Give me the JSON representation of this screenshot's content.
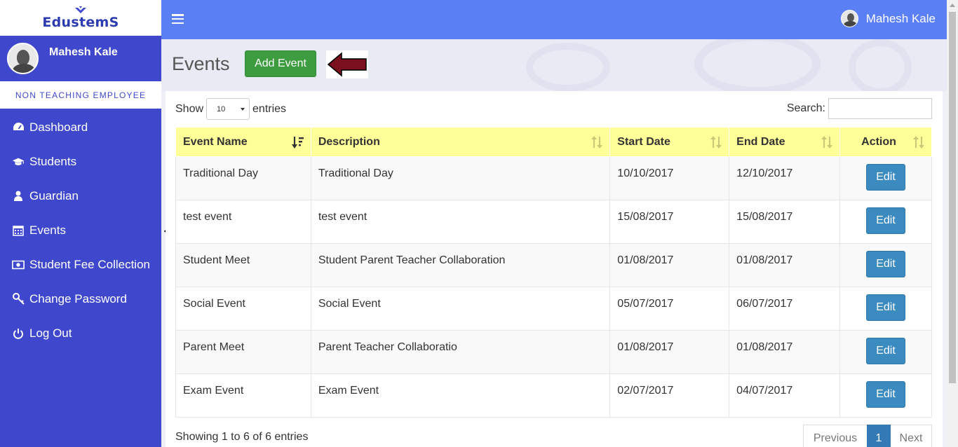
{
  "brand": {
    "logo_text": "EdustemS"
  },
  "user": {
    "name": "Mahesh Kale",
    "role": "NON TEACHING EMPLOYEE"
  },
  "sidebar": {
    "items": [
      {
        "label": "Dashboard",
        "icon": "dashboard-icon"
      },
      {
        "label": "Students",
        "icon": "graduation-cap-icon"
      },
      {
        "label": "Guardian",
        "icon": "user-icon"
      },
      {
        "label": "Events",
        "icon": "calendar-icon"
      },
      {
        "label": "Student Fee Collection",
        "icon": "money-icon"
      },
      {
        "label": "Change Password",
        "icon": "key-icon"
      },
      {
        "label": "Log Out",
        "icon": "power-icon"
      }
    ]
  },
  "topbar": {
    "user_name": "Mahesh Kale"
  },
  "page": {
    "title": "Events",
    "add_button": "Add Event"
  },
  "table_controls": {
    "show_label": "Show",
    "entries_value": "10",
    "entries_label": "entries",
    "search_label": "Search:",
    "search_value": ""
  },
  "table": {
    "headers": [
      "Event Name",
      "Description",
      "Start Date",
      "End Date",
      "Action"
    ],
    "rows": [
      {
        "name": "Traditional Day",
        "description": "Traditional Day",
        "start": "10/10/2017",
        "end": "12/10/2017",
        "action": "Edit"
      },
      {
        "name": "test event",
        "description": "test event",
        "start": "15/08/2017",
        "end": "15/08/2017",
        "action": "Edit"
      },
      {
        "name": "Student Meet",
        "description": "Student Parent Teacher Collaboration",
        "start": "01/08/2017",
        "end": "01/08/2017",
        "action": "Edit"
      },
      {
        "name": "Social Event",
        "description": "Social Event",
        "start": "05/07/2017",
        "end": "06/07/2017",
        "action": "Edit"
      },
      {
        "name": "Parent Meet",
        "description": "Parent Teacher Collaboratio",
        "start": "01/08/2017",
        "end": "01/08/2017",
        "action": "Edit"
      },
      {
        "name": "Exam Event",
        "description": "Exam Event",
        "start": "02/07/2017",
        "end": "04/07/2017",
        "action": "Edit"
      }
    ]
  },
  "footer": {
    "info": "Showing 1 to 6 of 6 entries"
  },
  "pagination": {
    "previous": "Previous",
    "current": "1",
    "next": "Next"
  },
  "colors": {
    "sidebar_bg": "#3f48cc",
    "topbar_bg": "#5b7ff5",
    "header_row_bg": "#ffff99",
    "add_button_bg": "#3d9c3f",
    "edit_button_bg": "#3b8bc0",
    "annotation_arrow": "#7a0f1e"
  }
}
